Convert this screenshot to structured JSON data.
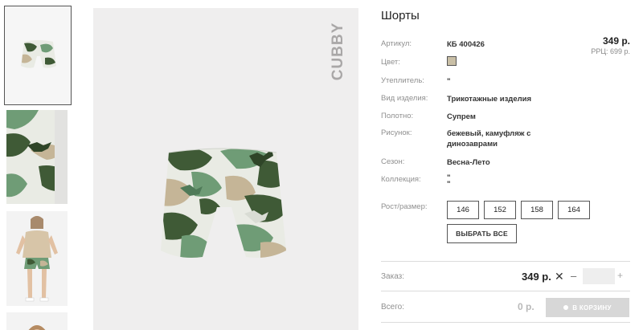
{
  "product": {
    "title": "Шорты",
    "price": "349 р.",
    "rrp": "РРЦ: 699 р.",
    "brand": "CUBBY"
  },
  "specs": {
    "article": {
      "label": "Артикул:",
      "value": "КБ 400426"
    },
    "color": {
      "label": "Цвет:",
      "swatch": "#c9bfa6"
    },
    "insulation": {
      "label": "Утеплитель:",
      "value": "\""
    },
    "type": {
      "label": "Вид изделия:",
      "value": "Трикотажные изделия"
    },
    "fabric": {
      "label": "Полотно:",
      "value": "Супрем"
    },
    "pattern": {
      "label": "Рисунок:",
      "value": "бежевый, камуфляж с динозаврами"
    },
    "season": {
      "label": "Сезон:",
      "value": "Весна-Лето"
    },
    "collection": {
      "label": "Коллекция:",
      "value": "\"\n\""
    }
  },
  "sizes": {
    "label": "Рост/размер:",
    "options": [
      "146",
      "152",
      "158",
      "164"
    ],
    "pick_all": "ВЫБРАТЬ ВСЕ"
  },
  "order": {
    "label": "Заказ:",
    "price": "349 р.",
    "x": "✕",
    "minus": "–",
    "plus": "+",
    "qty": ""
  },
  "total": {
    "label": "Всего:",
    "value": "0 р.",
    "cart_button": "В КОРЗИНУ"
  },
  "colors": {
    "camo_dark": "#3f5a36",
    "camo_green": "#6f9c76",
    "camo_beige": "#c5b597",
    "camo_light": "#e9ebe4"
  }
}
